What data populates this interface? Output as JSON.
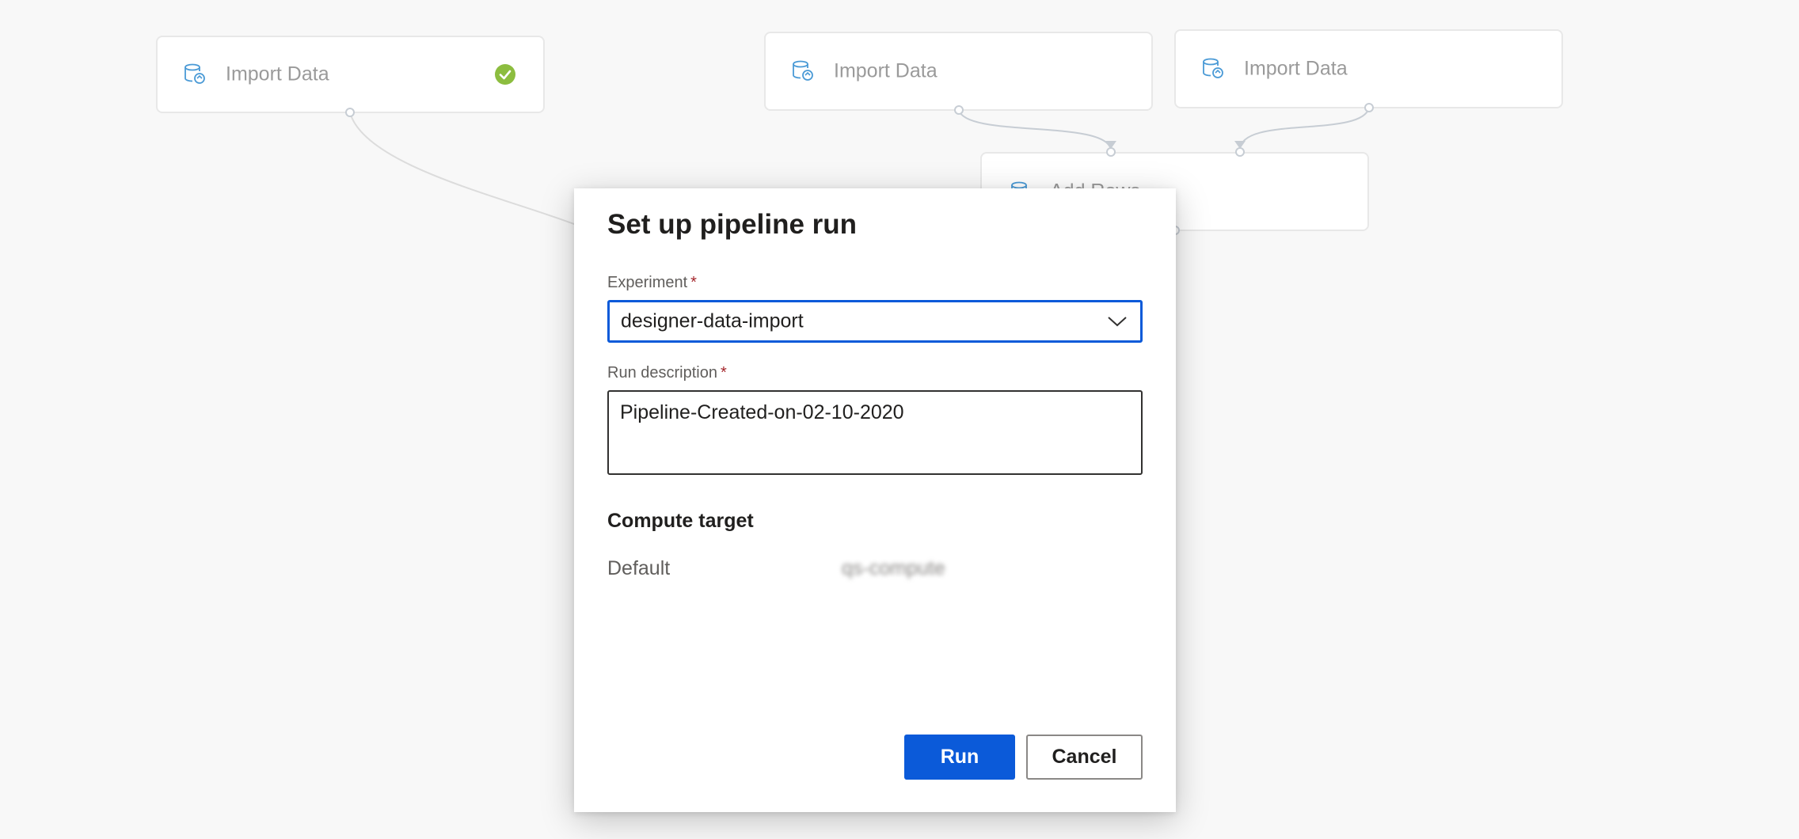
{
  "canvas": {
    "modules": [
      {
        "label": "Import Data",
        "icon": "import-data-icon",
        "status": "completed"
      },
      {
        "label": "Import Data",
        "icon": "import-data-icon",
        "status": ""
      },
      {
        "label": "Import Data",
        "icon": "import-data-icon",
        "status": ""
      },
      {
        "label": "Add Rows",
        "icon": "add-rows-icon",
        "status": ""
      }
    ]
  },
  "dialog": {
    "title": "Set up pipeline run",
    "experiment": {
      "label": "Experiment",
      "required_mark": "*",
      "value": "designer-data-import"
    },
    "run_description": {
      "label": "Run description",
      "required_mark": "*",
      "value": "Pipeline-Created-on-02-10-2020"
    },
    "compute_target": {
      "heading": "Compute target",
      "default_label": "Default",
      "default_value": "qs-compute"
    },
    "buttons": {
      "run": "Run",
      "cancel": "Cancel"
    }
  },
  "colors": {
    "accent": "#0b5ad9",
    "success": "#8cbd3f",
    "required": "#a4262c",
    "icon_blue": "#4a9ad6"
  }
}
